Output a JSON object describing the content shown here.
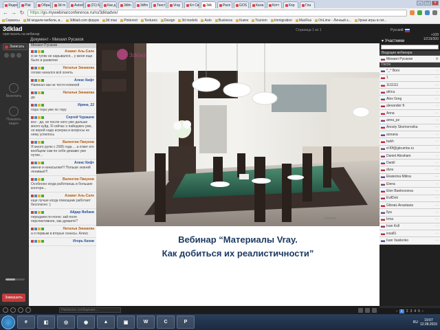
{
  "browser": {
    "tabs": [
      {
        "label": "Яндек",
        "active": false
      },
      {
        "label": "Plat",
        "active": false
      },
      {
        "label": "Образ",
        "active": false
      },
      {
        "label": "3d m",
        "active": false
      },
      {
        "label": "Autod",
        "active": false
      },
      {
        "label": "(21) M",
        "active": false
      },
      {
        "label": "Как д",
        "active": false
      },
      {
        "label": "3dlm",
        "active": false
      },
      {
        "label": "3dfm",
        "active": false
      },
      {
        "label": "Текст",
        "active": false
      },
      {
        "label": "Vray",
        "active": false
      },
      {
        "label": "Кл Свет",
        "active": false
      },
      {
        "label": "3dk",
        "active": true
      },
      {
        "label": "Расп",
        "active": false
      },
      {
        "label": "GOS",
        "active": false
      },
      {
        "label": "Кала",
        "active": false
      },
      {
        "label": "Котт",
        "active": false
      },
      {
        "label": "Кор",
        "active": false
      },
      {
        "label": "Гла",
        "active": false
      }
    ],
    "window_buttons": [
      "_",
      "□",
      "x"
    ],
    "nav": {
      "back": "←",
      "forward": "→",
      "reload": "↻"
    },
    "url_https": "https://",
    "url_rest": "go.mywebinarconference.ru/ru/3dkladvix/",
    "bookmarks": [
      "Сервисы",
      "3d модели мебели, в...",
      "3dklad.com форум",
      "3d max",
      "Pinterest",
      "Textures",
      "Design",
      "3d models",
      "Auto",
      "Business",
      "Книги",
      "Tourism",
      "Immigration",
      "MaxRus",
      "OnLime - Личный к...",
      "Уроки игры в гит..."
    ]
  },
  "app": {
    "logo": "3dklad",
    "logo_sub": "пригласить на вебинар",
    "doc_title": "Документ - Михаил Русаков",
    "page_indicator": "Страница 1 из 1",
    "language": "Русский",
    "stats": [
      "+109",
      "1/219/300"
    ]
  },
  "left": {
    "record_label": "Записать",
    "cam1": "Включить",
    "cam2": "Показать видео",
    "volume": 0.5,
    "end_label": "Завершить"
  },
  "chat": {
    "header": "Михаил Русаков",
    "messages": [
      {
        "author": "Азамат Аль-Сале",
        "color": "orange",
        "text": "я не тупяк не нарывался... у меня еще было в развитии"
      },
      {
        "author": "Наталья Зинакова",
        "color": "orange",
        "text": "готово начался всё хочеть"
      },
      {
        "author": "Алекс Кифт",
        "color": "blue",
        "text": "Написал как не тесто-плинкой"
      },
      {
        "author": "Наталья Зинакова",
        "color": "orange",
        "text": "да"
      },
      {
        "author": "Ирина_22",
        "color": "blue",
        "text": "пора тора уже по тору"
      },
      {
        "author": "Сергей Чурашев",
        "color": "blue",
        "text": "все - да, не после него уже дальше много куйд. Я сейчас о пайнджен уже, но верей надо искерка и вопросы не нему успелось"
      },
      {
        "author": "Валентин Пакунов",
        "color": "orange",
        "text": "Я много рулю с 2005 года ... а ответ кто вообщем сам по себе дежавю уже путие..."
      },
      {
        "author": "Алекс Кифт",
        "color": "blue",
        "text": "имени и начасылки!!! Польше знаний ленивые!!!"
      },
      {
        "author": "Валентин Пакунов",
        "color": "orange",
        "text": "Особенно когда работаешь в больших конторе..."
      },
      {
        "author": "Азамат Аль-Сале",
        "color": "orange",
        "text": "еще лучше когда помощник работает бесплатно :)"
      },
      {
        "author": "Айдар Янбаев",
        "color": "blue",
        "text": "передаем по-полю: зай-поля перспективнее, как думаете?"
      },
      {
        "author": "Наталья Зинакова",
        "color": "orange",
        "text": "а я первым в вторые сеансы. Алекс"
      },
      {
        "author": "Игорь Кахов",
        "color": "blue",
        "text": ""
      }
    ]
  },
  "slide": {
    "watermark": "Гитчего",
    "line1": "Вебинар “Материалы Vray.",
    "line2": "Как добиться их реалистичности”"
  },
  "participants": {
    "header": "Участники",
    "section_host": "Ведущие вебинара",
    "host": "Михаил Русаков",
    "section_guests": "Гости",
    "guests": [
      "^_^ Boni",
      "1",
      "1111111",
      "africa",
      "Alex Greg",
      "alexander ft",
      "Anna",
      "anna_pz",
      "Anosty Skomorovika",
      "annana",
      "bukh",
      "d-f0f@gkrumbs.ru",
      "Daniel Abraham",
      "Daniil",
      "dura",
      "Ekaterina Mitina",
      "Elena",
      "Elen Bankovoeva",
      "EvilDek",
      "Gibrais Anastasia",
      "Ilya",
      "Irma",
      "Ivan Koll",
      "ivsa81",
      "Ivan Vasilenko"
    ],
    "pages": [
      "‹",
      "1",
      "2",
      "3",
      "4",
      "5",
      "›"
    ],
    "current_page": "1"
  },
  "bottom": {
    "input_placeholder": "Написать сообщение..."
  },
  "taskbar": {
    "items": [
      "e",
      "◧",
      "◎",
      "◉",
      "▲",
      "▣",
      "W",
      "C",
      "P"
    ],
    "time": "19:07",
    "date": "12.08.2015",
    "lang": "RU"
  }
}
